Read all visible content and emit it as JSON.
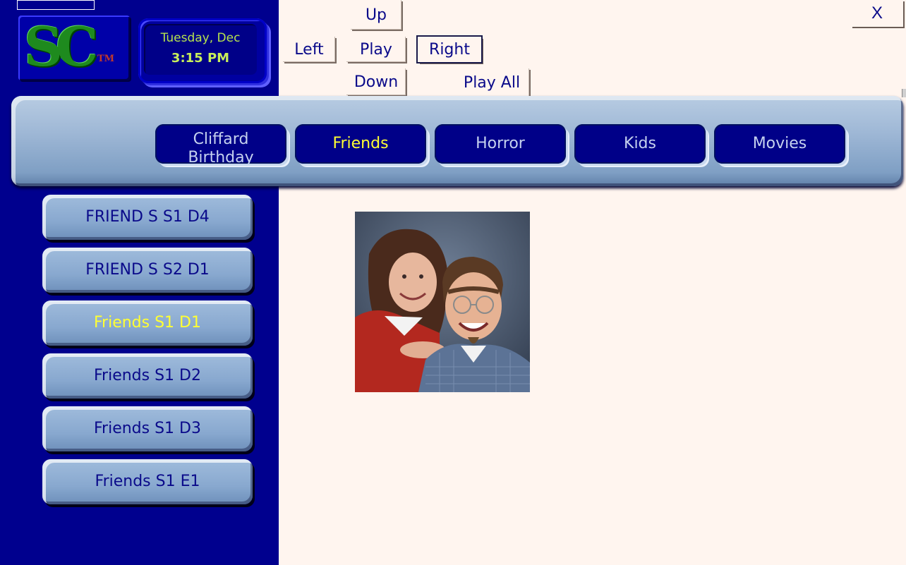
{
  "clock": {
    "date": "Tuesday, Dec",
    "time": "3:15 PM"
  },
  "logo": {
    "letters": "SC",
    "tm": "TM"
  },
  "controls": {
    "up": "Up",
    "left": "Left",
    "play": "Play",
    "right": "Right",
    "down": "Down",
    "play_all": "Play All",
    "close": "X"
  },
  "categories": [
    {
      "label": "Cliffard Birthday",
      "active": false
    },
    {
      "label": "Friends",
      "active": true
    },
    {
      "label": "Horror",
      "active": false
    },
    {
      "label": "Kids",
      "active": false
    },
    {
      "label": "Movies",
      "active": false
    }
  ],
  "items": [
    {
      "label": "FRIEND S S1 D4",
      "active": false
    },
    {
      "label": "FRIEND S S2 D1",
      "active": false
    },
    {
      "label": "Friends S1 D1",
      "active": true
    },
    {
      "label": "Friends S1 D2",
      "active": false
    },
    {
      "label": "Friends S1 D3",
      "active": false
    },
    {
      "label": "Friends S1 E1",
      "active": false
    }
  ],
  "colors": {
    "sidebar": "#00008e",
    "background": "#fff5ef",
    "active_text": "#ffff33",
    "inactive_text": "#c6d2ef",
    "clock_text": "#b6e34d"
  }
}
